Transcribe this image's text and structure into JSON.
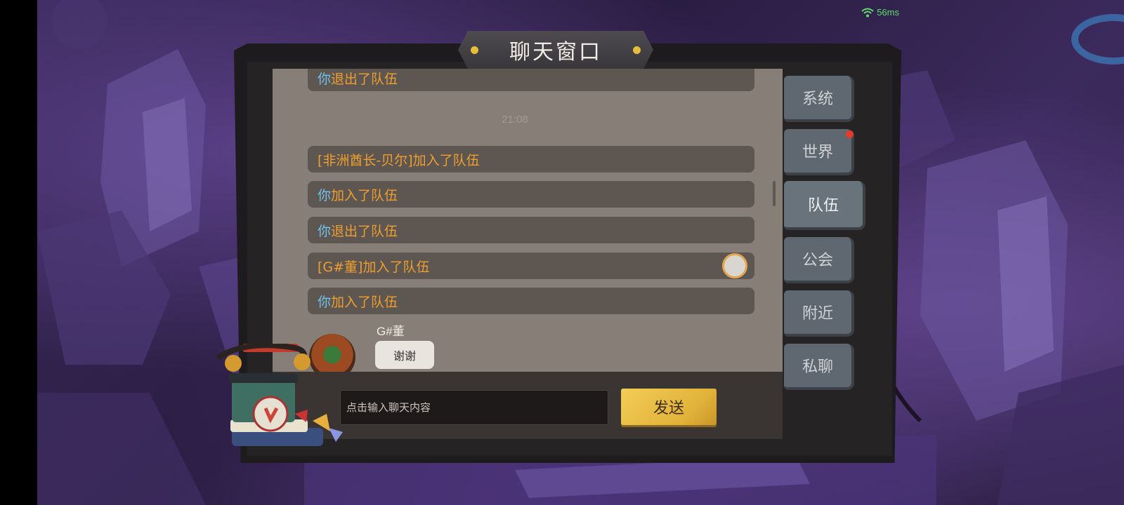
{
  "status": {
    "ping": "56ms"
  },
  "window": {
    "title": "聊天窗口"
  },
  "messages": [
    {
      "type": "system",
      "prefix": "你",
      "text": "退出了队伍"
    },
    {
      "type": "time",
      "text": "21:08"
    },
    {
      "type": "system",
      "prefix": "",
      "text": "[非洲酋长-贝尔]加入了队伍"
    },
    {
      "type": "system",
      "prefix": "你",
      "text": "加入了队伍"
    },
    {
      "type": "system",
      "prefix": "你",
      "text": "退出了队伍"
    },
    {
      "type": "system",
      "prefix": "",
      "text": "[G#董]加入了队伍"
    },
    {
      "type": "system",
      "prefix": "你",
      "text": "加入了队伍"
    },
    {
      "type": "player",
      "sender": "G#董",
      "text": "谢谢"
    }
  ],
  "input": {
    "placeholder": "点击输入聊天内容",
    "value": ""
  },
  "send_button": {
    "label": "发送"
  },
  "tabs": [
    {
      "label": "系统",
      "active": false
    },
    {
      "label": "世界",
      "active": false,
      "notification": true
    },
    {
      "label": "队伍",
      "active": true
    },
    {
      "label": "公会",
      "active": false
    },
    {
      "label": "附近",
      "active": false
    },
    {
      "label": "私聊",
      "active": false
    }
  ],
  "colors": {
    "system_text": "#ef9f2f",
    "you_text": "#74c3ea",
    "send_button": "#e9bf45",
    "notification_dot": "#e53a2a"
  }
}
